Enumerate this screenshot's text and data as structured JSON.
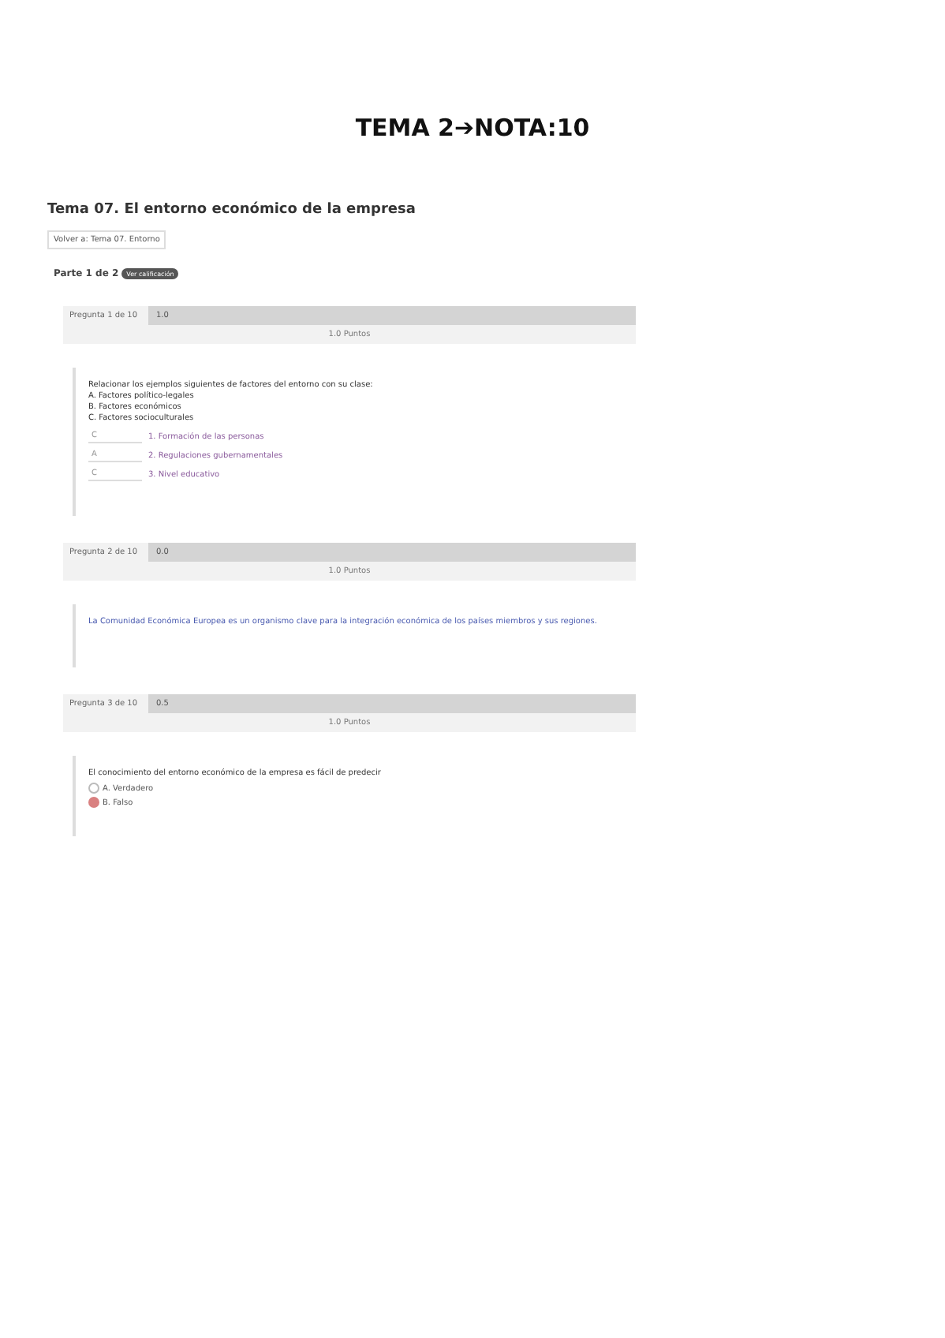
{
  "heading": "TEMA 2➔NOTA:10",
  "quiz": {
    "title": "Tema 07. El entorno económico de la empresa",
    "breadcrumb": "Volver a: Tema 07. Entorno",
    "part": "Parte 1 de 2",
    "part_badge": "Ver calificación",
    "questions": [
      {
        "kind": "matching",
        "label": "Pregunta 1 de 10",
        "score": "1.0",
        "points": "1.0 Puntos",
        "prompt": [
          "Relacionar los ejemplos siguientes de factores del entorno con su clase:",
          "A. Factores político-legales",
          "B. Factores económicos",
          "C. Factores socioculturales"
        ],
        "pairs": [
          {
            "answer": "C",
            "item": "1. Formación de las personas"
          },
          {
            "answer": "A",
            "item": "2. Regulaciones gubernamentales"
          },
          {
            "answer": "C",
            "item": "3. Nivel educativo"
          }
        ]
      },
      {
        "kind": "text",
        "label": "Pregunta 2 de 10",
        "score": "0.0",
        "points": "1.0 Puntos",
        "prompt": [
          "La Comunidad Económica Europea es un organismo clave para la integración económica de los países miembros y sus regiones."
        ]
      },
      {
        "kind": "choice",
        "label": "Pregunta 3 de 10",
        "score": "0.5",
        "points": "1.0 Puntos",
        "prompt": [
          "El conocimiento del entorno económico de la empresa es fácil de predecir"
        ],
        "options": [
          {
            "label": "A. Verdadero",
            "selected": false
          },
          {
            "label": "B. Falso",
            "selected": true
          }
        ]
      }
    ]
  }
}
